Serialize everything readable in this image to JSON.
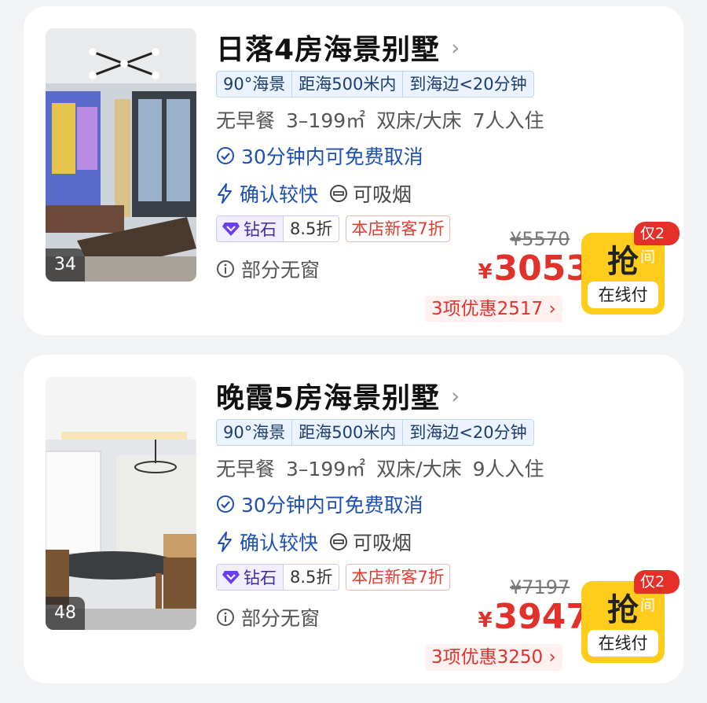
{
  "listings": [
    {
      "photo_count": "34",
      "title": "日落4房海景别墅",
      "features": [
        "90°海景",
        "距海500米内",
        "到海边<20分钟"
      ],
      "specs": [
        "无早餐",
        "3–199㎡",
        "双床/大床",
        "7人入住"
      ],
      "cancel_text": "30分钟内可免费取消",
      "confirm_text": "确认较快",
      "smoking_text": "可吸烟",
      "diamond_label": "钻石",
      "diamond_discount": "8.5折",
      "new_customer": "本店新客7折",
      "window_text": "部分无窗",
      "original_price": "¥5570",
      "currency": "¥",
      "price": "3053",
      "promo_text": "3项优惠2517 ›",
      "only_left": "仅2间",
      "grab_label": "抢",
      "pay_online": "在线付"
    },
    {
      "photo_count": "48",
      "title": "晚霞5房海景别墅",
      "features": [
        "90°海景",
        "距海500米内",
        "到海边<20分钟"
      ],
      "specs": [
        "无早餐",
        "3–199㎡",
        "双床/大床",
        "9人入住"
      ],
      "cancel_text": "30分钟内可免费取消",
      "confirm_text": "确认较快",
      "smoking_text": "可吸烟",
      "diamond_label": "钻石",
      "diamond_discount": "8.5折",
      "new_customer": "本店新客7折",
      "window_text": "部分无窗",
      "original_price": "¥7197",
      "currency": "¥",
      "price": "3947",
      "promo_text": "3项优惠3250 ›",
      "only_left": "仅2间",
      "grab_label": "抢",
      "pay_online": "在线付"
    }
  ],
  "colors": {
    "price_red": "#e0312b",
    "link_blue": "#1e4fb2",
    "grab_yellow": "#ffcc1c",
    "diamond_purple": "#6a3df0"
  },
  "icons": {
    "title_chevron": "chevron-right-icon",
    "cancel": "check-circle-icon",
    "confirm": "lightning-icon",
    "smoking": "smoking-icon",
    "diamond": "diamond-icon",
    "window": "info-icon"
  }
}
